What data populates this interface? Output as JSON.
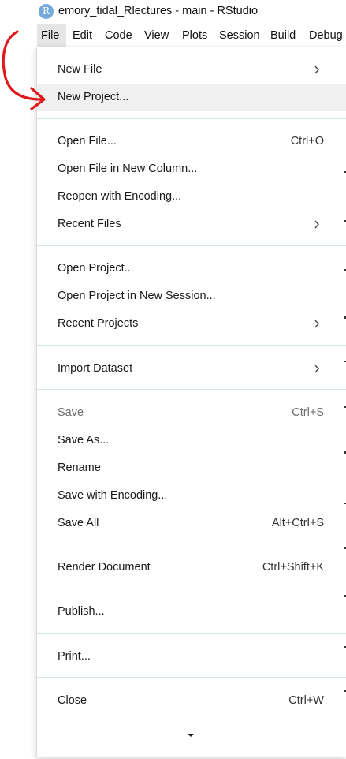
{
  "window": {
    "icon_letter": "R",
    "title": "emory_tidal_Rlectures - main - RStudio"
  },
  "menubar": {
    "items": [
      "File",
      "Edit",
      "Code",
      "View",
      "Plots",
      "Session",
      "Build",
      "Debug"
    ]
  },
  "file_menu": {
    "new_file": "New File",
    "new_project": "New Project...",
    "open_file": "Open File...",
    "open_file_shortcut": "Ctrl+O",
    "open_file_new_column": "Open File in New Column...",
    "reopen_with_encoding": "Reopen with Encoding...",
    "recent_files": "Recent Files",
    "open_project": "Open Project...",
    "open_project_new_session": "Open Project in New Session...",
    "recent_projects": "Recent Projects",
    "import_dataset": "Import Dataset",
    "save": "Save",
    "save_shortcut": "Ctrl+S",
    "save_as": "Save As...",
    "rename": "Rename",
    "save_with_encoding": "Save with Encoding...",
    "save_all": "Save All",
    "save_all_shortcut": "Alt+Ctrl+S",
    "render_document": "Render Document",
    "render_document_shortcut": "Ctrl+Shift+K",
    "publish": "Publish...",
    "print": "Print...",
    "close": "Close",
    "close_shortcut": "Ctrl+W"
  },
  "colors": {
    "annotation_arrow": "#e0191c",
    "highlight": "#f0f0f0",
    "separator": "#d4e2e4",
    "app_icon": "#75a9dc"
  },
  "icons": {
    "app": "rstudio-logo-icon",
    "submenu": "chevron-right-icon",
    "more": "caret-down-icon"
  }
}
